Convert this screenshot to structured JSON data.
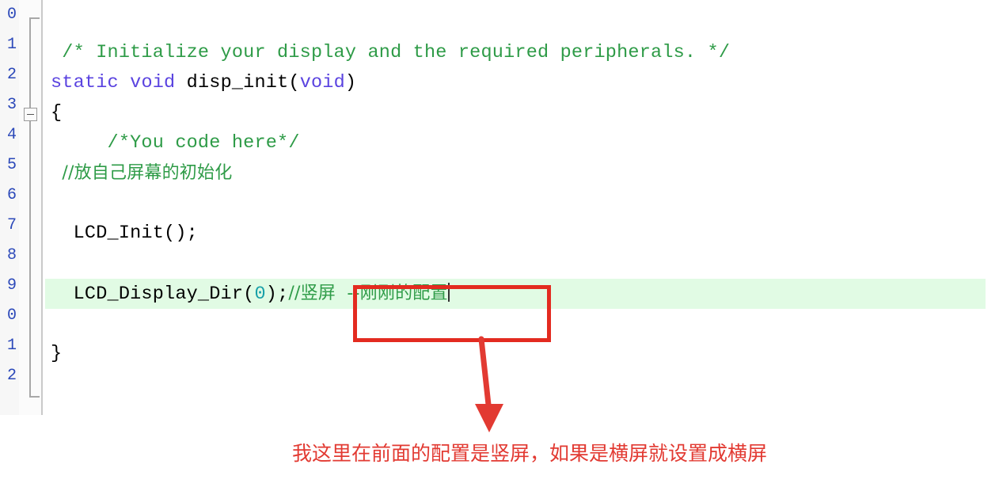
{
  "editor": {
    "language": "c",
    "highlight_color": "#e1fbe4",
    "gutter": {
      "line_numbers": [
        "0",
        "1",
        "2",
        "3",
        "4",
        "5",
        "6",
        "7",
        "8",
        "9",
        "0",
        "1",
        "2"
      ],
      "fold_marker": "-"
    },
    "lines": [
      {
        "n": "0",
        "segments": []
      },
      {
        "n": "1",
        "segments": [
          {
            "t": " /* Initialize your display and the required peripherals. */",
            "k": "cmt"
          }
        ]
      },
      {
        "n": "2",
        "segments": [
          {
            "t": "static",
            "k": "kw"
          },
          {
            "t": " ",
            "k": "pln"
          },
          {
            "t": "void",
            "k": "kw"
          },
          {
            "t": " disp_init(",
            "k": "pln"
          },
          {
            "t": "void",
            "k": "kw"
          },
          {
            "t": ")",
            "k": "pln"
          }
        ]
      },
      {
        "n": "3",
        "segments": [
          {
            "t": "{",
            "k": "pln"
          }
        ]
      },
      {
        "n": "4",
        "segments": [
          {
            "t": "     /*You code here*/",
            "k": "cmt"
          }
        ]
      },
      {
        "n": "5",
        "segments": [
          {
            "t": "  //放自己屏幕的初始化",
            "k": "cmt"
          }
        ]
      },
      {
        "n": "6",
        "segments": []
      },
      {
        "n": "7",
        "segments": [
          {
            "t": "  LCD_Init();",
            "k": "pln"
          }
        ]
      },
      {
        "n": "8",
        "segments": []
      },
      {
        "n": "9",
        "segments": [
          {
            "t": "  LCD_Display_Dir(",
            "k": "pln"
          },
          {
            "t": "0",
            "k": "num"
          },
          {
            "t": ");",
            "k": "pln"
          },
          {
            "t": "//竖屏  --刚刚的配置",
            "k": "cmt"
          }
        ]
      },
      {
        "n": "0",
        "segments": []
      },
      {
        "n": "1",
        "segments": [
          {
            "t": "}",
            "k": "pln"
          }
        ]
      },
      {
        "n": "2",
        "segments": []
      }
    ],
    "highlighted_line_index": 9,
    "caret_line_index": 9
  },
  "annotation": {
    "box_color": "#e32b20",
    "arrow_color": "#e23a32",
    "text_color": "#e23a32",
    "text": "我这里在前面的配置是竖屏，如果是横屏就设置成横屏",
    "boxed_text": ";//竖屏  --刚刚的配置"
  }
}
